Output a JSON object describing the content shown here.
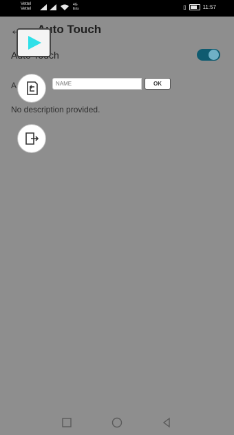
{
  "status_bar": {
    "carrier1": "Vettel",
    "carrier2": "Vettel",
    "network1": "4G",
    "network2": "Eris",
    "time": "11:57",
    "icons": [
      "signal-icon",
      "wifi-icon",
      "vibrate-icon",
      "battery-icon"
    ]
  },
  "app_bar": {
    "title": "Auto Touch",
    "back_icon": "back-arrow-icon"
  },
  "settings": {
    "toggle_label": "Auto Touch",
    "toggle_on": true,
    "row2_prefix": "A",
    "description": "No description provided."
  },
  "overlay": {
    "play_icon": "play-icon",
    "export_icon": "export-icon",
    "save_icon": "save-file-icon",
    "name_placeholder": "NAME",
    "ok_label": "OK"
  },
  "navigation": {
    "recent_icon": "square-icon",
    "home_icon": "circle-icon",
    "back_icon": "triangle-back-icon"
  },
  "colors": {
    "dim_background": "#8e8e8e",
    "toggle_track": "#0f5b70",
    "toggle_knob": "#6fb0c6",
    "play_icon": "#2fe0e8",
    "status_bar": "#000000"
  }
}
